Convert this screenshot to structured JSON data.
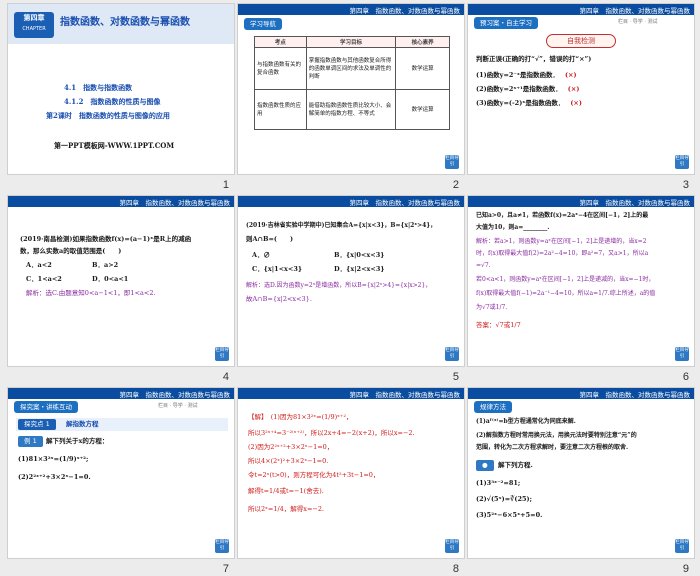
{
  "header_title": "第四章　指数函数、对数函数与幂函数",
  "corner_btn": "栏目导引",
  "slides": [
    {
      "num": "1",
      "chapter_badge_cn": "第四章",
      "chapter_badge_en": "CHAPTER",
      "title": "指数函数、对数函数与幂函数",
      "sec1": "4.1　指数与指数函数",
      "sec2": "4.1.2　指数函数的性质与图像",
      "sec3": "第2课时　指数函数的性质与图像的应用",
      "footer": "第一PPT模板网-WWW.1PPT.COM"
    },
    {
      "num": "2",
      "tag": "学习导航",
      "table_headers": [
        "考点",
        "学习目标",
        "核心素养"
      ],
      "rows": [
        {
          "topic": "与指数函数有关的复合函数",
          "goal": "掌握指数函数与其他函数复合所得的函数单调区间的求法及单调性的判断",
          "core": "数学运算"
        },
        {
          "topic": "指数函数性质的应用",
          "goal": "能借助指数函数性质比较大小、会解简单的指数方程、不等式",
          "core": "数学运算"
        }
      ]
    },
    {
      "num": "3",
      "tag": "预习案・自主学习",
      "subnav": "栏目 · 导学 · 测试",
      "badge": "自我检测",
      "q_title": "判断正误(正确的打“√”，错误的打“×”)",
      "items": [
        {
          "text": "(1)函数y=2⁻ˣ是指数函数．",
          "mark": "(×)"
        },
        {
          "text": "(2)函数y=2ˣ⁺¹是指数函数．",
          "mark": "(×)"
        },
        {
          "text": "(3)函数y=(-2)ˣ是指数函数．",
          "mark": "(×)"
        }
      ]
    },
    {
      "num": "4",
      "problem_l1": "(2019·南昌检测)如果指数函数f(x)=(a−1)ˣ是R上的减函",
      "problem_l2": "数，那么实数a的取值范围是(　　)",
      "opt_a": "A．a<2",
      "opt_b": "B．a>2",
      "opt_c": "C．1<a<2",
      "opt_d": "D．0<a<1",
      "solution": "解析：选C.由题意知0<a−1<1，即1<a<2."
    },
    {
      "num": "5",
      "problem_l1": "(2019·吉林省实验中学期中)已知集合A={x|x<3}，B={x|2ˣ>4}，",
      "problem_l2": "则A∩B=(　　)",
      "opt_a": "A．∅",
      "opt_b": "B．{x|0<x<3}",
      "opt_c": "C．{x|1<x<3}",
      "opt_d": "D．{x|2<x<3}",
      "sol_l1": "解析：选D.因为函数y=2ˣ是增函数，所以B={x|2ˣ>4}={x|x>2}，",
      "sol_l2": "故A∩B={x|2<x<3}."
    },
    {
      "num": "6",
      "lines": [
        "已知a>0，且a≠1，若函数f(x)=2aˣ−4在区间[−1，2]上的最",
        "大值为10，则a=________.",
        "解析：若a>1，则函数y=aˣ在区间[−1，2]上是递增的，当x=2",
        "时，f(x)取得最大值f(2)=2a²−4=10，即a²=7，又a>1，所以a",
        "=√7.",
        "若0<a<1，则函数y=aˣ在区间[−1，2]上是递减的，当x=−1时，",
        "f(x)取得最大值f(−1)=2a⁻¹−4=10，所以a=1/7.综上所述，a的值",
        "为√7或1/7.",
        "答案：√7或1/7"
      ]
    },
    {
      "num": "7",
      "tag": "探究案・讲练互动",
      "subnav": "栏目 · 导学 · 测试",
      "section_label": "探究点 1",
      "section_title": "解指数方程",
      "example_label": "例 1",
      "example_text": "解下列关于x的方程：",
      "eq1": "(1)81×3²ˣ=(1/9)ˣ⁺²;",
      "eq2": "(2)2²ˣ⁺²+3×2ˣ−1=0."
    },
    {
      "num": "8",
      "lines": [
        "【解】　(1)因为81×3²ˣ=(1/9)ˣ⁺²，",
        "所以3²ˣ⁺⁴=3⁻²⁽ˣ⁺²⁾，所以2x+4=−2(x+2)，所以x=−2.",
        "(2)因为2²ˣ⁺²+3×2ˣ−1=0，",
        "所以4×(2ˣ)²+3×2ˣ−1=0.",
        "令t=2ˣ(t>0)，则方程可化为4t²+3t−1=0，",
        "解得t=1/4或t=−1(舍去).",
        "所以2ˣ=1/4，解得x=−2."
      ]
    },
    {
      "num": "9",
      "tag": "规律方法",
      "lines": [
        "(1)aᶠ⁽ˣ⁾=b型方程通常化为同底来解.",
        "(2)解指数方程时常用换元法，用换元法时要特别注意“元”的",
        "范围，转化为二次方程求解时，要注意二次方程根的取舍."
      ],
      "practice_title": "解下列方程.",
      "practice": [
        "(1)3³ˣ⁻²=81;",
        "(2)√(5ˣ)=∛(25);",
        "(3)5²ˣ−6×5ˣ+5=0."
      ]
    }
  ]
}
